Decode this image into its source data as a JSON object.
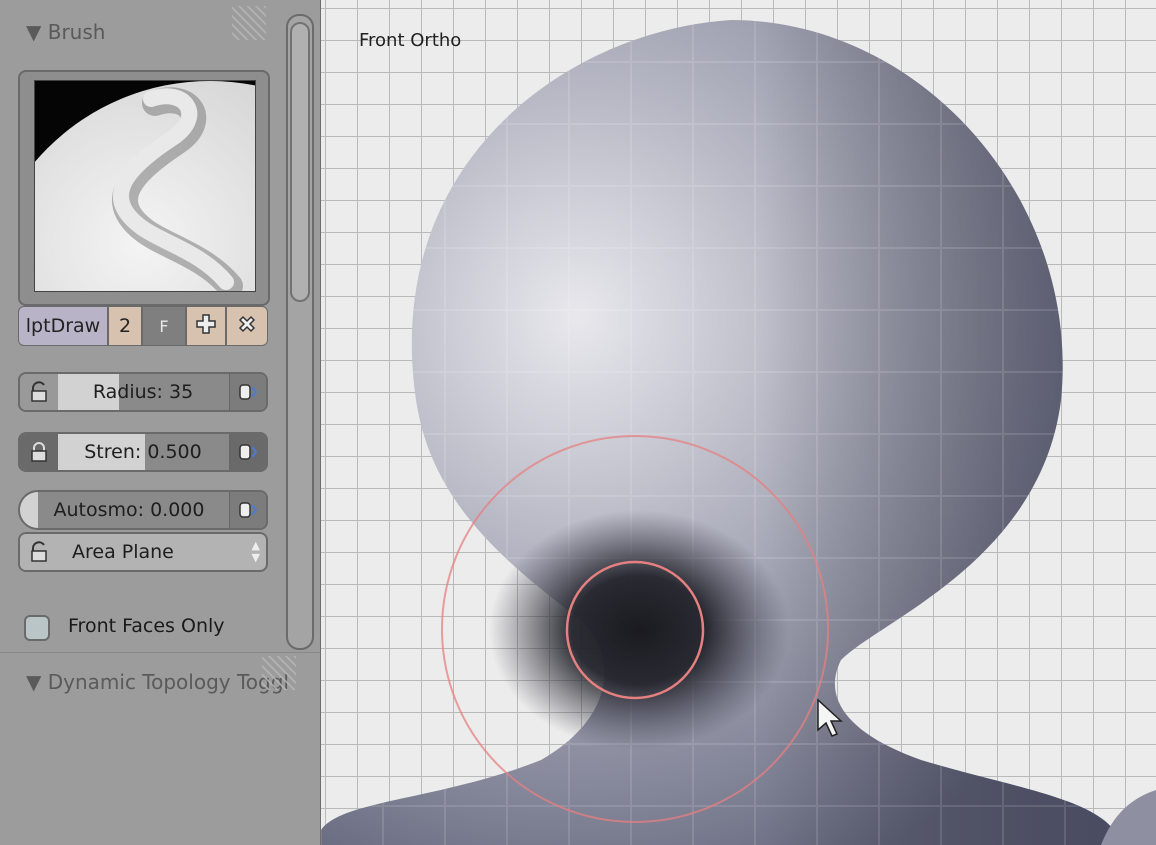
{
  "panel": {
    "brush_header": "▼ Brush",
    "brush_name": "lptDraw",
    "users_count": "2",
    "fake_user": "F",
    "radius_label": "Radius: 35",
    "radius_fraction": 0.35,
    "strength_label": "Stren: 0.500",
    "strength_fraction": 0.5,
    "autosmooth_label": "Autosmo: 0.000",
    "autosmooth_fraction": 0.0,
    "sculpt_plane": "Area Plane",
    "front_faces_only": "Front Faces Only",
    "front_faces_checked": false,
    "dyntopo_header": "▼ Dynamic Topology Toggl"
  },
  "viewport": {
    "view_label": "Front Ortho"
  },
  "icons": [
    "lock-icon",
    "pen-pressure-icon",
    "add-icon",
    "close-icon",
    "updown-arrows-icon",
    "cursor-arrow-icon",
    "collapse-triangle-icon"
  ],
  "colors": {
    "panel_bg": "#9c9c9c",
    "viewport_bg": "#ececec",
    "grid_line": "#b9b9b9",
    "mesh": "#9a9cab",
    "brush_circle": "#e58080",
    "brush_name_bg": "#b8b3c6",
    "button_tan": "#d6c2ae"
  }
}
